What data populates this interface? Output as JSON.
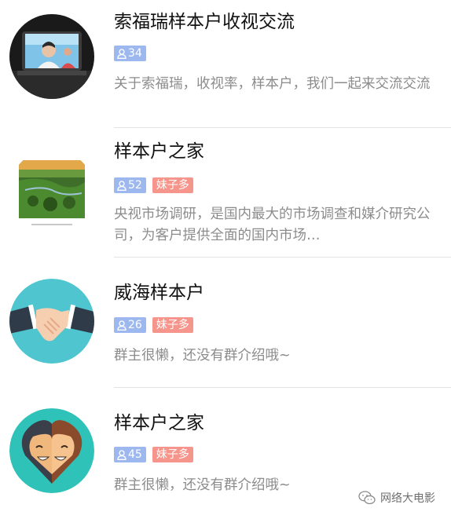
{
  "groups": [
    {
      "name": "索福瑞样本户收视交流",
      "members": "34",
      "tag": "",
      "description": "关于索福瑞，收视率，样本户，我们一起来交流交流",
      "avatar": "tv-screen-photo"
    },
    {
      "name": "样本户之家",
      "members": "52",
      "tag": "妹子多",
      "description": "央视市场调研，是国内最大的市场调查和媒介研究公司，为客户提供全面的国内市场…",
      "avatar": "landscape-photo"
    },
    {
      "name": "威海样本户",
      "members": "26",
      "tag": "妹子多",
      "description": "群主很懒，还没有群介绍哦~",
      "avatar": "handshake-icon"
    },
    {
      "name": "样本户之家",
      "members": "45",
      "tag": "妹子多",
      "description": "群主很懒，还没有群介绍哦~",
      "avatar": "two-faces-icon"
    }
  ],
  "watermark": {
    "text": "网络大电影",
    "icon": "wechat-icon"
  },
  "colors": {
    "member_badge": "#9db8ef",
    "hot_badge": "#f6958b",
    "description": "#8c8c8c",
    "divider": "#e3e3e3"
  }
}
